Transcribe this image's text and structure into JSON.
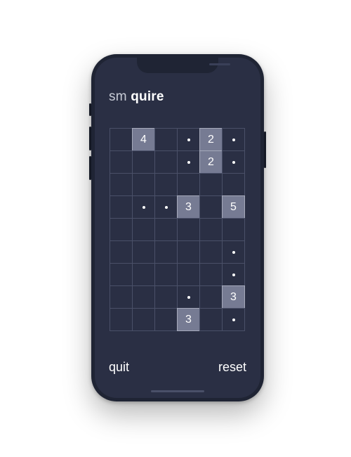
{
  "app": {
    "title_prefix": "sm",
    "title_main": "quire"
  },
  "board": {
    "rows": 9,
    "cols": 6,
    "cells": [
      [
        "",
        "4",
        "",
        "dot",
        "2",
        "dot"
      ],
      [
        "",
        "",
        "",
        "dot",
        "2",
        "dot"
      ],
      [
        "",
        "",
        "",
        "",
        "",
        ""
      ],
      [
        "",
        "dot",
        "dot",
        "3",
        "",
        "5"
      ],
      [
        "",
        "",
        "",
        "",
        "",
        ""
      ],
      [
        "",
        "",
        "",
        "",
        "",
        "dot"
      ],
      [
        "",
        "",
        "",
        "",
        "",
        "dot"
      ],
      [
        "",
        "",
        "",
        "dot",
        "",
        "3"
      ],
      [
        "",
        "",
        "",
        "3",
        "",
        "dot"
      ]
    ]
  },
  "footer": {
    "quit_label": "quit",
    "reset_label": "reset"
  }
}
